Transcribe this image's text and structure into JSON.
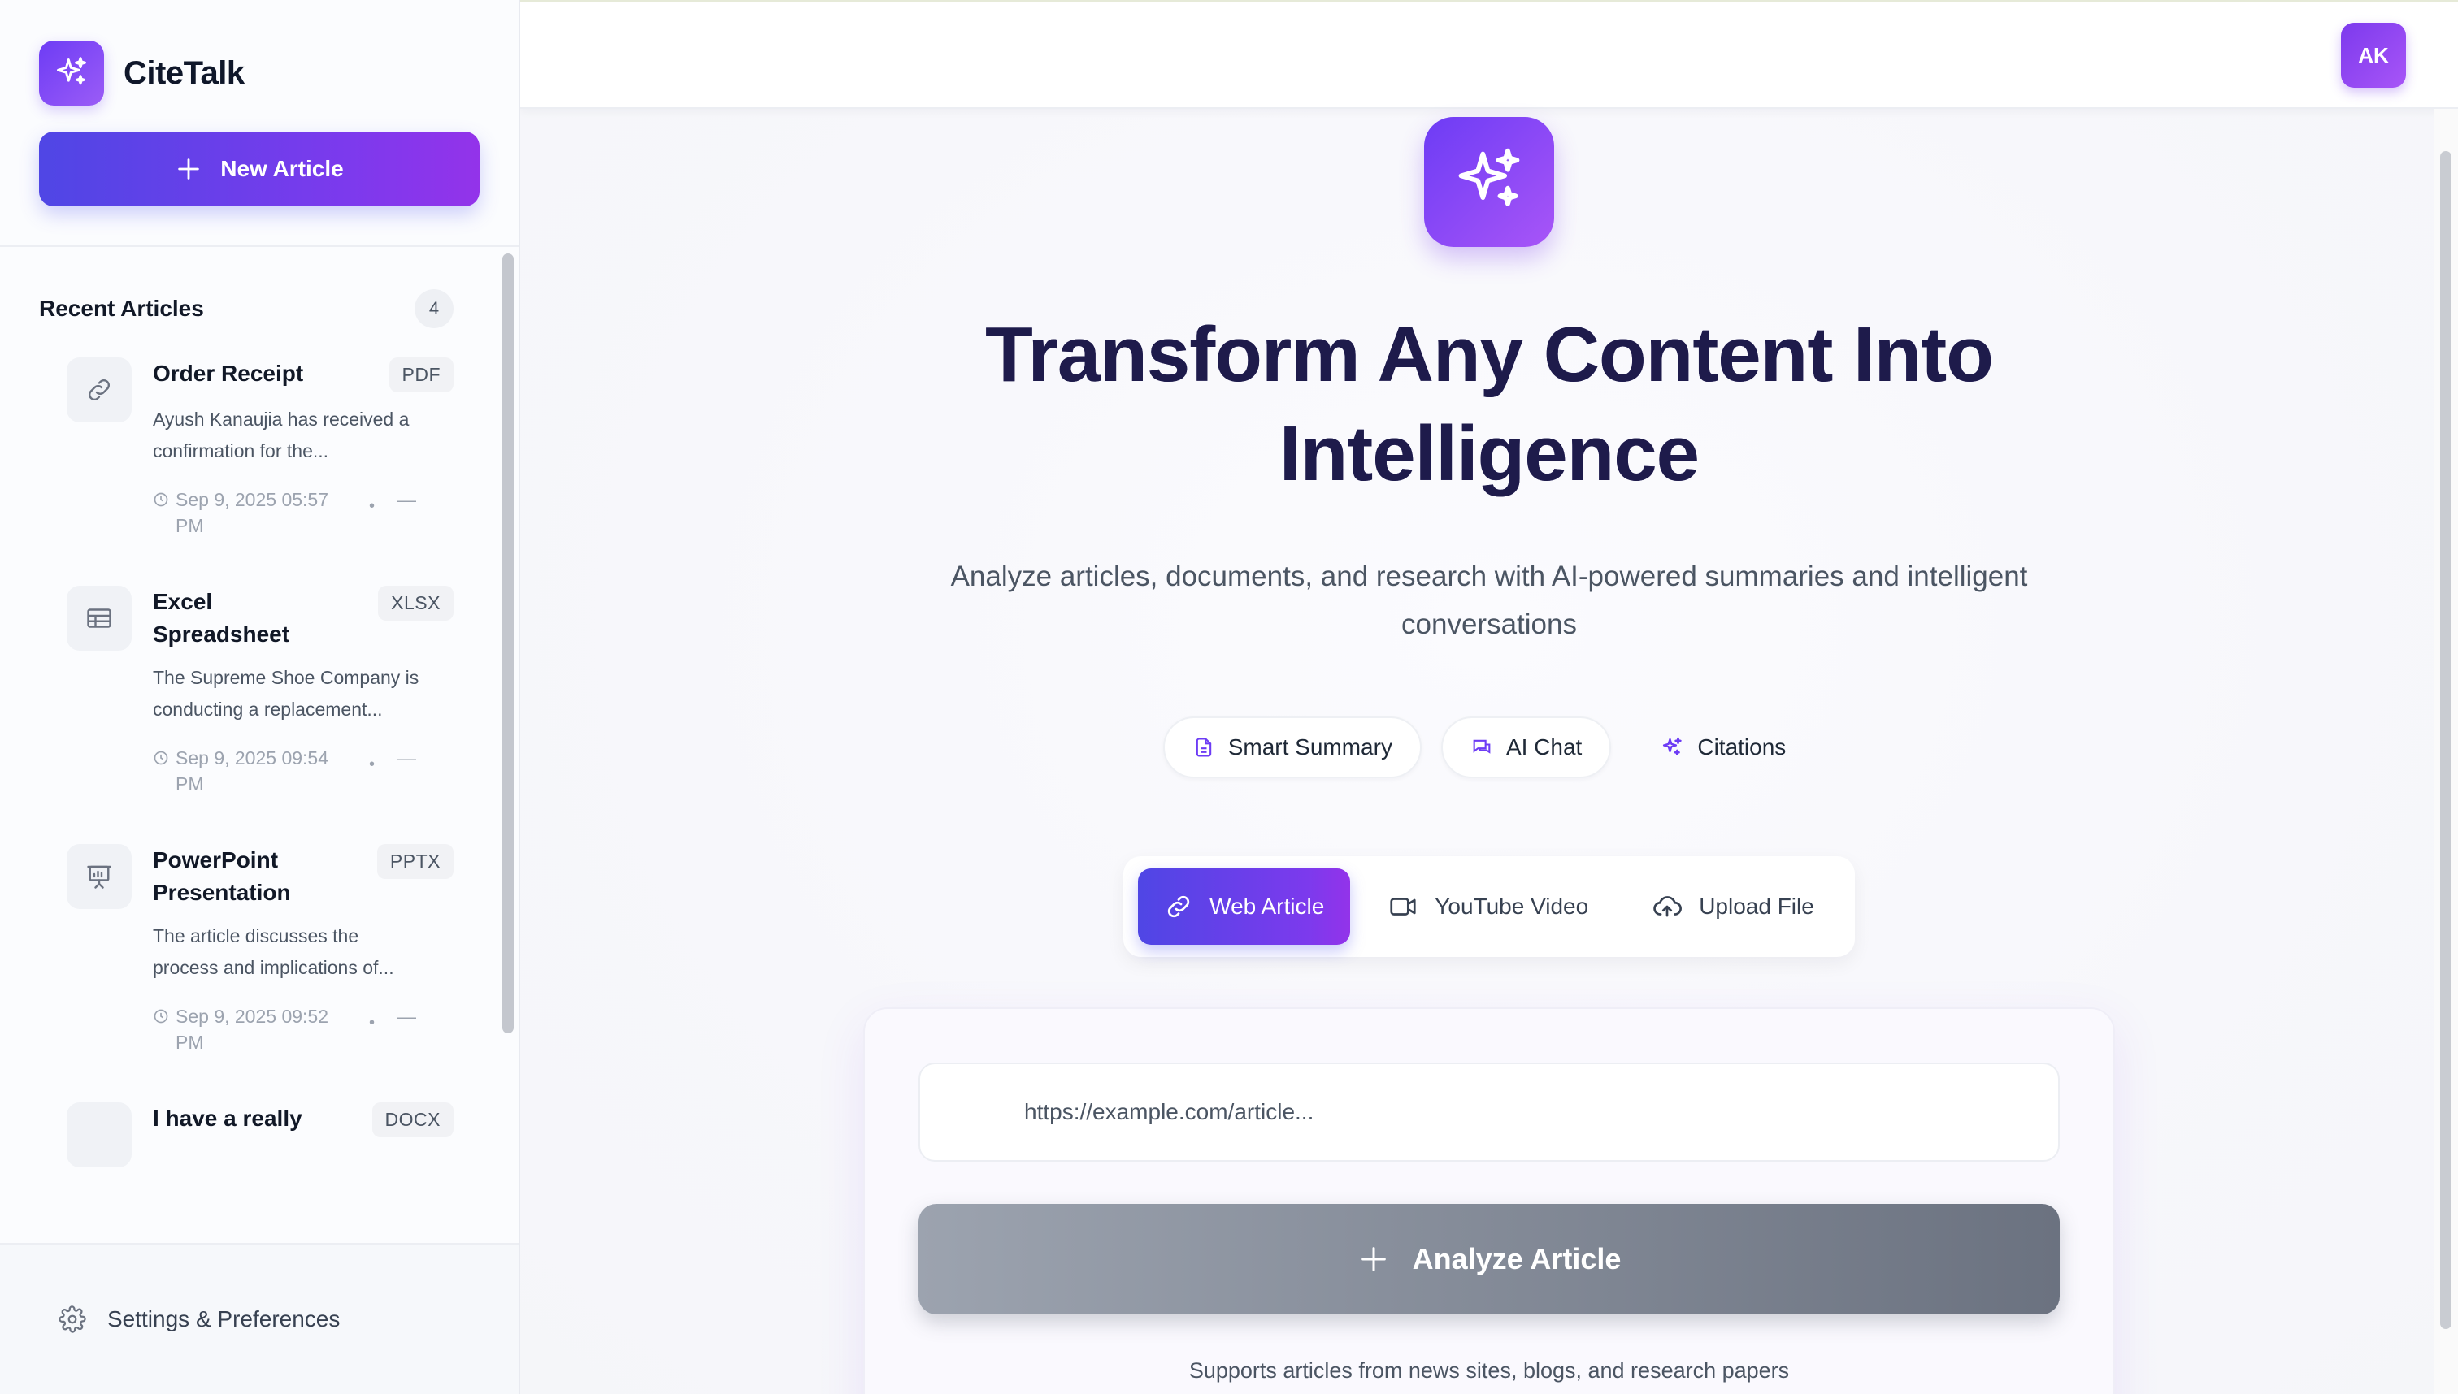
{
  "brand": {
    "name": "CiteTalk",
    "icon": "sparkles-icon"
  },
  "sidebar": {
    "new_article_label": "New Article",
    "recent_title": "Recent Articles",
    "recent_count": "4",
    "articles": [
      {
        "title": "Order Receipt",
        "type": "PDF",
        "icon": "link-icon",
        "description": "Ayush Kanaujia has received a confirmation for the...",
        "date": "Sep 9, 2025 05:57 PM"
      },
      {
        "title": "Excel Spreadsheet",
        "type": "XLSX",
        "icon": "table-icon",
        "description": "The Supreme Shoe Company is conducting a replacement...",
        "date": "Sep 9, 2025 09:54 PM"
      },
      {
        "title": "PowerPoint Presentation",
        "type": "PPTX",
        "icon": "presentation-icon",
        "description": "The article discusses the process and implications of...",
        "date": "Sep 9, 2025 09:52 PM"
      },
      {
        "title": "I have a really",
        "type": "DOCX",
        "icon": "doc-icon",
        "description": "",
        "date": ""
      }
    ],
    "settings_label": "Settings & Preferences"
  },
  "header": {
    "avatar_initials": "AK"
  },
  "hero": {
    "title": "Transform Any Content Into Intelligence",
    "subtitle": "Analyze articles, documents, and research with AI-powered summaries and intelligent conversations"
  },
  "features": [
    {
      "label": "Smart Summary",
      "icon": "document-icon"
    },
    {
      "label": "AI Chat",
      "icon": "chat-icon"
    },
    {
      "label": "Citations",
      "icon": "sparkles-icon"
    }
  ],
  "source_tabs": [
    {
      "label": "Web Article",
      "icon": "link-icon",
      "active": true
    },
    {
      "label": "YouTube Video",
      "icon": "video-icon",
      "active": false
    },
    {
      "label": "Upload File",
      "icon": "upload-cloud-icon",
      "active": false
    }
  ],
  "form": {
    "url_placeholder": "https://example.com/article...",
    "url_value": "",
    "analyze_label": "Analyze Article",
    "support_note": "Supports articles from news sites, blogs, and research papers"
  },
  "colors": {
    "accent_start": "#4f46e5",
    "accent_end": "#9333ea",
    "title_color": "#1e1b4b",
    "disabled_button": "#6b7280"
  }
}
